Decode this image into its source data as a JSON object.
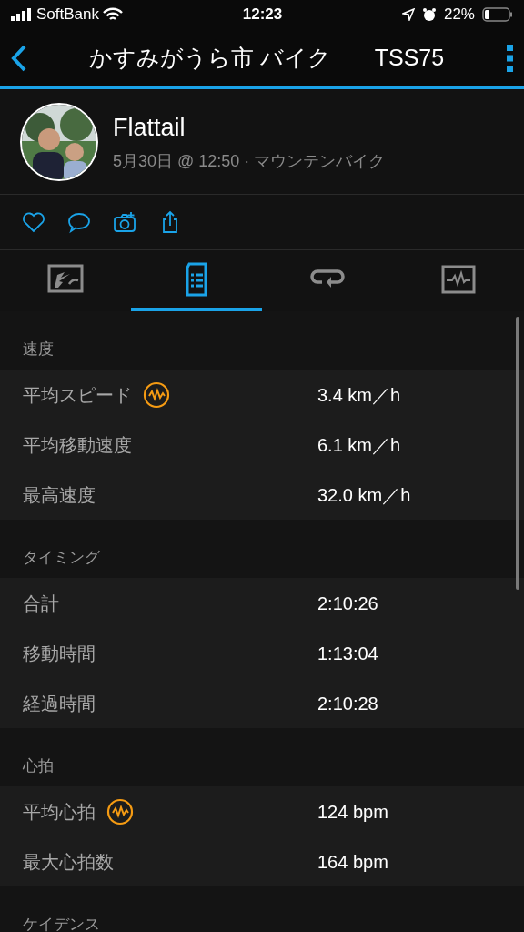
{
  "status_bar": {
    "carrier": "SoftBank",
    "time": "12:23",
    "battery": "22%"
  },
  "header": {
    "title": "かすみがうら市 バイク",
    "tss": "TSS75"
  },
  "profile": {
    "name": "Flattail",
    "meta": "5月30日 @ 12:50 · マウンテンバイク"
  },
  "tabs": [
    {
      "kind": "map",
      "selected": false
    },
    {
      "kind": "stats",
      "selected": true
    },
    {
      "kind": "laps",
      "selected": false
    },
    {
      "kind": "charts",
      "selected": false
    }
  ],
  "sections": [
    {
      "title": "速度",
      "rows": [
        {
          "label": "平均スピード",
          "value": "3.4 km／h",
          "badge": true
        },
        {
          "label": "平均移動速度",
          "value": "6.1 km／h",
          "badge": false
        },
        {
          "label": "最高速度",
          "value": "32.0 km／h",
          "badge": false
        }
      ]
    },
    {
      "title": "タイミング",
      "rows": [
        {
          "label": "合計",
          "value": "2:10:26",
          "badge": false
        },
        {
          "label": "移動時間",
          "value": "1:13:04",
          "badge": false
        },
        {
          "label": "経過時間",
          "value": "2:10:28",
          "badge": false
        }
      ]
    },
    {
      "title": "心拍",
      "rows": [
        {
          "label": "平均心拍",
          "value": "124 bpm",
          "badge": true
        },
        {
          "label": "最大心拍数",
          "value": "164 bpm",
          "badge": false
        }
      ]
    },
    {
      "title": "ケイデンス"
    }
  ]
}
